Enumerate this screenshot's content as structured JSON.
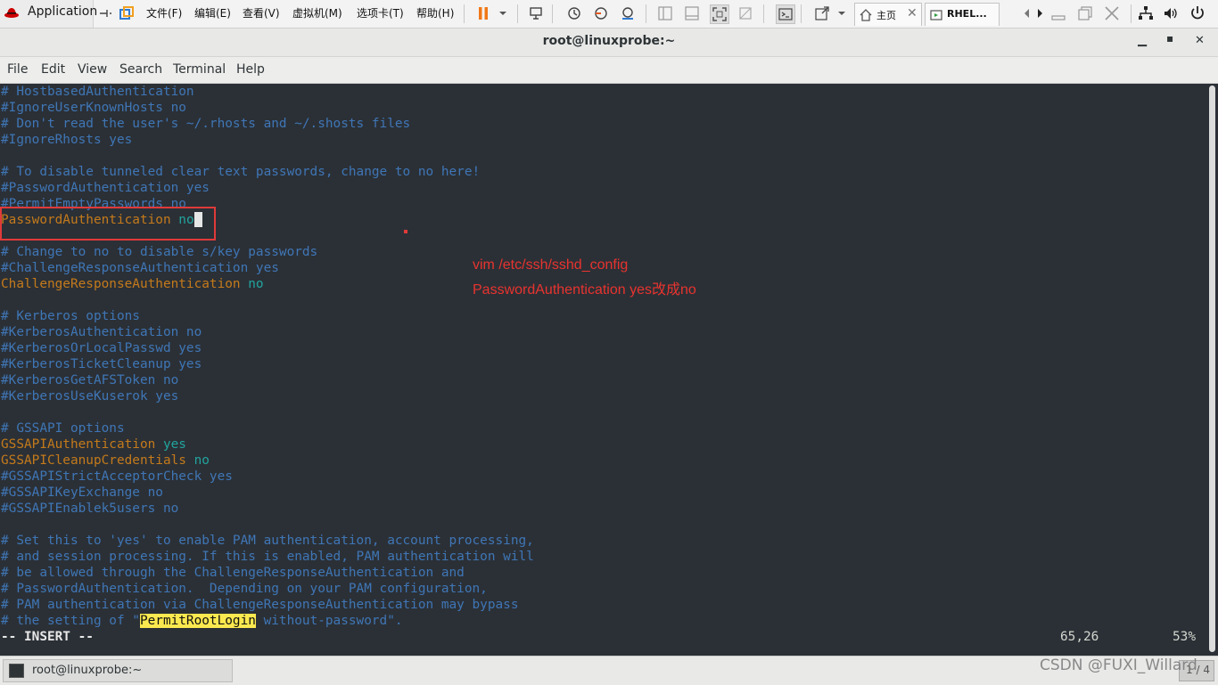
{
  "host": {
    "apps_label": "Application",
    "menus": [
      "文件(F)",
      "编辑(E)",
      "查看(V)",
      "虚拟机(M)",
      "选项卡(T)",
      "帮助(H)"
    ],
    "tabs": [
      {
        "label": "主页"
      },
      {
        "label": "RHEL..."
      }
    ]
  },
  "window": {
    "title": "root@linuxprobe:~",
    "minimize": "▁",
    "maximize": "▪",
    "close": "✕"
  },
  "menubar": [
    "File",
    "Edit",
    "View",
    "Search",
    "Terminal",
    "Help"
  ],
  "terminal": {
    "lines": [
      {
        "type": "comment",
        "text": "# HostbasedAuthentication"
      },
      {
        "type": "comment",
        "text": "#IgnoreUserKnownHosts no"
      },
      {
        "type": "comment",
        "text": "# Don't read the user's ~/.rhosts and ~/.shosts files"
      },
      {
        "type": "comment",
        "text": "#IgnoreRhosts yes"
      },
      {
        "type": "blank",
        "text": ""
      },
      {
        "type": "comment",
        "text": "# To disable tunneled clear text passwords, change to no here!"
      },
      {
        "type": "comment",
        "text": "#PasswordAuthentication yes"
      },
      {
        "type": "comment",
        "text": "#PermitEmptyPasswords no"
      },
      {
        "type": "kv",
        "key": "PasswordAuthentication",
        "value": "no",
        "cursor": true
      },
      {
        "type": "blank",
        "text": ""
      },
      {
        "type": "comment",
        "text": "# Change to no to disable s/key passwords"
      },
      {
        "type": "comment",
        "text": "#ChallengeResponseAuthentication yes"
      },
      {
        "type": "kv",
        "key": "ChallengeResponseAuthentication",
        "value": "no"
      },
      {
        "type": "blank",
        "text": ""
      },
      {
        "type": "comment",
        "text": "# Kerberos options"
      },
      {
        "type": "comment",
        "text": "#KerberosAuthentication no"
      },
      {
        "type": "comment",
        "text": "#KerberosOrLocalPasswd yes"
      },
      {
        "type": "comment",
        "text": "#KerberosTicketCleanup yes"
      },
      {
        "type": "comment",
        "text": "#KerberosGetAFSToken no"
      },
      {
        "type": "comment",
        "text": "#KerberosUseKuserok yes"
      },
      {
        "type": "blank",
        "text": ""
      },
      {
        "type": "comment",
        "text": "# GSSAPI options"
      },
      {
        "type": "kv",
        "key": "GSSAPIAuthentication",
        "value": "yes"
      },
      {
        "type": "kv",
        "key": "GSSAPICleanupCredentials",
        "value": "no"
      },
      {
        "type": "comment",
        "text": "#GSSAPIStrictAcceptorCheck yes"
      },
      {
        "type": "comment",
        "text": "#GSSAPIKeyExchange no"
      },
      {
        "type": "comment",
        "text": "#GSSAPIEnablek5users no"
      },
      {
        "type": "blank",
        "text": ""
      },
      {
        "type": "comment",
        "text": "# Set this to 'yes' to enable PAM authentication, account processing,"
      },
      {
        "type": "comment",
        "text": "# and session processing. If this is enabled, PAM authentication will"
      },
      {
        "type": "comment",
        "text": "# be allowed through the ChallengeResponseAuthentication and"
      },
      {
        "type": "comment",
        "text": "# PasswordAuthentication.  Depending on your PAM configuration,"
      },
      {
        "type": "comment",
        "text": "# PAM authentication via ChallengeResponseAuthentication may bypass"
      },
      {
        "type": "comment_hl",
        "before": "# the setting of \"",
        "highlight": "PermitRootLogin",
        "after": " without-password\"."
      }
    ],
    "status": {
      "mode": "-- INSERT --",
      "position": "65,26",
      "percent": "53%"
    }
  },
  "annotation": {
    "line1": "vim /etc/ssh/sshd_config",
    "line2": "PasswordAuthentication yes改成no",
    "color": "#e8332f"
  },
  "taskbar": {
    "item_label": "root@linuxprobe:~",
    "workspace": "1 / 4",
    "watermark": "CSDN @FUXI_Willard"
  }
}
